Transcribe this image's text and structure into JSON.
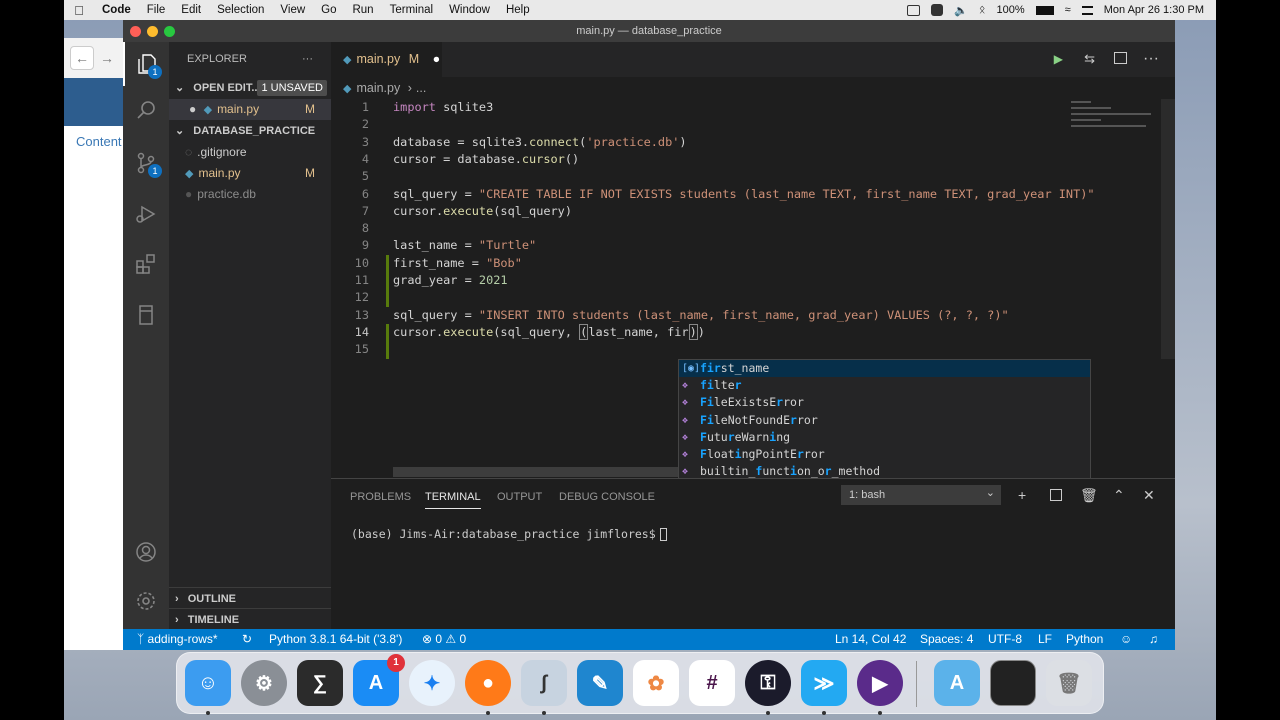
{
  "menubar": {
    "app": "Code",
    "items": [
      "File",
      "Edit",
      "Selection",
      "View",
      "Go",
      "Run",
      "Terminal",
      "Window",
      "Help"
    ],
    "battery": "100%",
    "clock": "Mon Apr 26  1:30 PM"
  },
  "browser": {
    "content_label": "Content"
  },
  "window": {
    "title": "main.py — database_practice"
  },
  "activity": {
    "explorer_badge": "1",
    "scm_badge": "1"
  },
  "sidebar": {
    "header": "EXPLORER",
    "more": "···",
    "open_editors": "OPEN EDIT...",
    "unsaved": "1 UNSAVED",
    "open_file": "main.py",
    "open_file_status": "M",
    "folder": "DATABASE_PRACTICE",
    "files": [
      {
        "name": ".gitignore",
        "status": ""
      },
      {
        "name": "main.py",
        "status": "M"
      },
      {
        "name": "practice.db",
        "status": ""
      }
    ],
    "outline": "OUTLINE",
    "timeline": "TIMELINE"
  },
  "editor": {
    "tab_label": "main.py",
    "tab_status": "M",
    "breadcrumb_file": "main.py",
    "breadcrumb_more": "...",
    "line_numbers": [
      "1",
      "2",
      "3",
      "4",
      "5",
      "6",
      "7",
      "8",
      "9",
      "10",
      "11",
      "12",
      "13",
      "14",
      "15"
    ]
  },
  "suggest": {
    "items": [
      {
        "pre": "",
        "hl": "fir",
        "post": "st_name",
        "kind": "variable"
      },
      {
        "pre": "",
        "hl": "fi",
        "post": "lte",
        "hl2": "r",
        "post2": "",
        "kind": "class"
      },
      {
        "pre": "",
        "hl": "Fi",
        "post": "leExistsE",
        "hl2": "r",
        "post2": "ror",
        "kind": "class"
      },
      {
        "pre": "",
        "hl": "Fi",
        "post": "leNotFoundE",
        "hl2": "r",
        "post2": "ror",
        "kind": "class"
      },
      {
        "pre": "",
        "hl": "F",
        "post": "utu",
        "hl2": "r",
        "post2": "eWarn",
        "hl3": "i",
        "post3": "ng",
        "kind": "class"
      },
      {
        "pre": "",
        "hl": "F",
        "post": "loat",
        "hl2": "i",
        "post2": "ngPointE",
        "hl3": "r",
        "post3": "ror",
        "kind": "class"
      },
      {
        "pre": "builtin_",
        "hl": "f",
        "post": "unct",
        "hl2": "i",
        "post2": "on_o",
        "hl3": "r",
        "post3": "_method",
        "kind": "class"
      }
    ]
  },
  "panel": {
    "tabs": [
      "PROBLEMS",
      "TERMINAL",
      "OUTPUT",
      "DEBUG CONSOLE"
    ],
    "terminal_select": "1: bash",
    "prompt": "(base) Jims-Air:database_practice jimflores$"
  },
  "statusbar": {
    "branch": "adding-rows*",
    "python": "Python 3.8.1 64-bit ('3.8')",
    "errors": "0",
    "warnings": "0",
    "position": "Ln 14, Col 42",
    "spaces": "Spaces: 4",
    "encoding": "UTF-8",
    "eol": "LF",
    "language": "Python"
  },
  "dock": {
    "appstore_badge": "1"
  },
  "colors": {
    "statusbar": "#007acc",
    "activity": "#333333",
    "sidebar": "#252526",
    "editor": "#1e1e1e"
  }
}
